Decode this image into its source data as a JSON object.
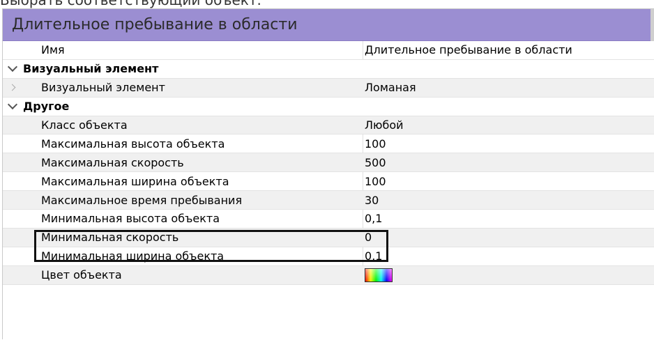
{
  "page": {
    "top_note": "Выбрать соответствующий объект."
  },
  "panel": {
    "title": "Длительное пребывание в области",
    "rows": [
      {
        "type": "property",
        "name": "Имя",
        "value": "Длительное пребывание в области",
        "icon": "none"
      },
      {
        "type": "category",
        "name": "Визуальный элемент",
        "value": "",
        "icon": "chevron-down-icon"
      },
      {
        "type": "property",
        "name": "Визуальный элемент",
        "value": "Ломаная",
        "icon": "chevron-right-icon"
      },
      {
        "type": "category",
        "name": "Другое",
        "value": "",
        "icon": "chevron-down-icon"
      },
      {
        "type": "property",
        "name": "Класс объекта",
        "value": "Любой",
        "icon": "none"
      },
      {
        "type": "property",
        "name": "Максимальная высота объекта",
        "value": "100",
        "icon": "none"
      },
      {
        "type": "property",
        "name": "Максимальная скорость",
        "value": "500",
        "icon": "none"
      },
      {
        "type": "property",
        "name": "Максимальная ширина объекта",
        "value": "100",
        "icon": "none"
      },
      {
        "type": "property",
        "name": "Максимальное время пребывания",
        "value": "30",
        "icon": "none",
        "highlighted": true
      },
      {
        "type": "property",
        "name": "Минимальная высота объекта",
        "value": "0,1",
        "icon": "none"
      },
      {
        "type": "property",
        "name": "Минимальная скорость",
        "value": "0",
        "icon": "none"
      },
      {
        "type": "property",
        "name": "Минимальная ширина объекта",
        "value": "0,1",
        "icon": "none"
      },
      {
        "type": "property",
        "name": "Цвет объекта",
        "value": "",
        "icon": "color-swatch"
      }
    ]
  },
  "colors": {
    "header_bg": "#9b8ed2",
    "highlight_border": "#111111"
  }
}
